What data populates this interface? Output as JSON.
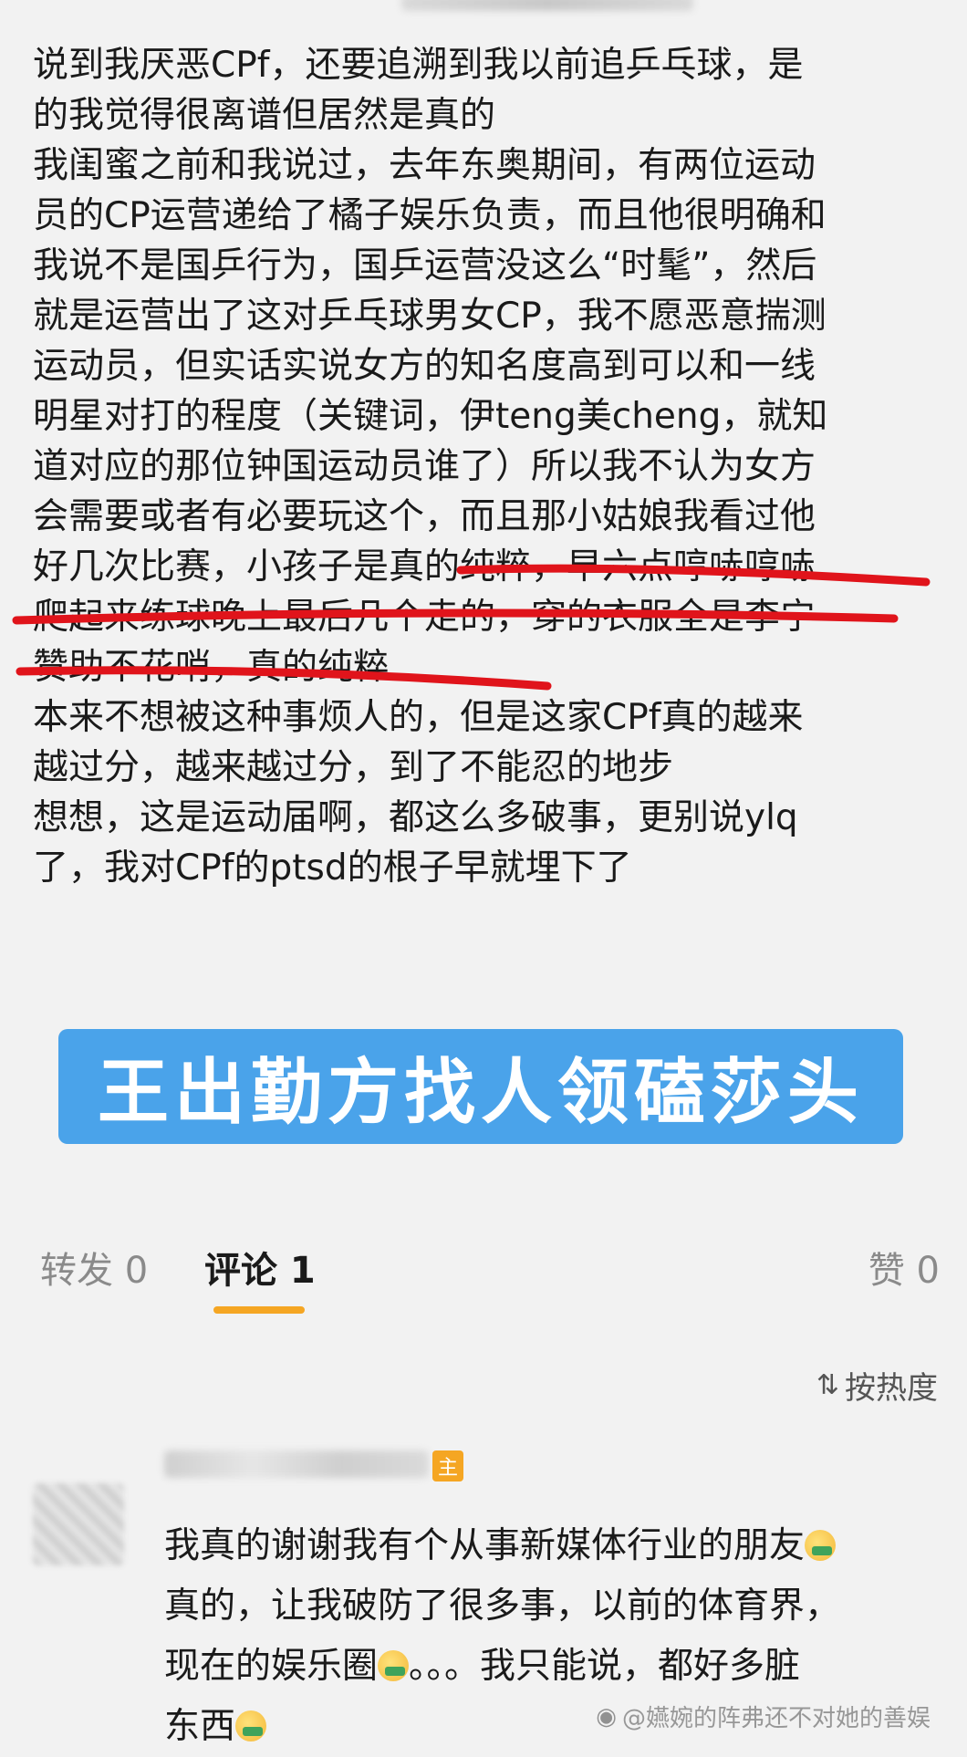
{
  "post": {
    "lines": [
      "说到我厌恶CPf，还要追溯到我以前追乒乓球，是",
      "的我觉得很离谱但居然是真的",
      "我闺蜜之前和我说过，去年东奥期间，有两位运动",
      "员的CP运营递给了橘子娱乐负责，而且他很明确和",
      "我说不是国乒行为，国乒运营没这么“时髦”，然后",
      "就是运营出了这对乒乓球男女CP，我不愿恶意揣测",
      "运动员，但实话实说女方的知名度高到可以和一线",
      "明星对打的程度（关键词，伊teng美cheng，就知",
      "道对应的那位钟国运动员谁了）所以我不认为女方",
      "会需要或者有必要玩这个，而且那小姑娘我看过他",
      "好几次比赛，小孩子是真的纯粹，早六点哼哧哼哧",
      "爬起来练球晚上最后几个走的，穿的衣服全是李宁",
      "赞助不花哨，真的纯粹",
      "本来不想被这种事烦人的，但是这家CPf真的越来",
      "越过分，越来越过分，到了不能忍的地步",
      "想想，这是运动届啊，都这么多破事，更别说ylq",
      "了，我对CPf的ptsd的根子早就埋下了"
    ],
    "underline_color": "#e0141b"
  },
  "banner": {
    "text": "王出勤方找人领磕莎头",
    "bg_color": "#4aa3ea"
  },
  "tabs": {
    "repost": "转发 0",
    "comment": "评论 1",
    "like": "赞 0",
    "indicator_color": "#f5a623"
  },
  "sort": {
    "icon": "sort-icon",
    "label": "按热度"
  },
  "comment": {
    "badge": "主",
    "lines": [
      "我真的谢谢我有个从事新媒体行业的朋友",
      "真的，让我破防了很多事，以前的体育界，",
      "现在的娱乐圈",
      "东西"
    ],
    "line3_suffix": "。。。我只能说，都好多脏"
  },
  "watermark": {
    "text": "@嬿婉的阵弗还不对她的善娱"
  }
}
